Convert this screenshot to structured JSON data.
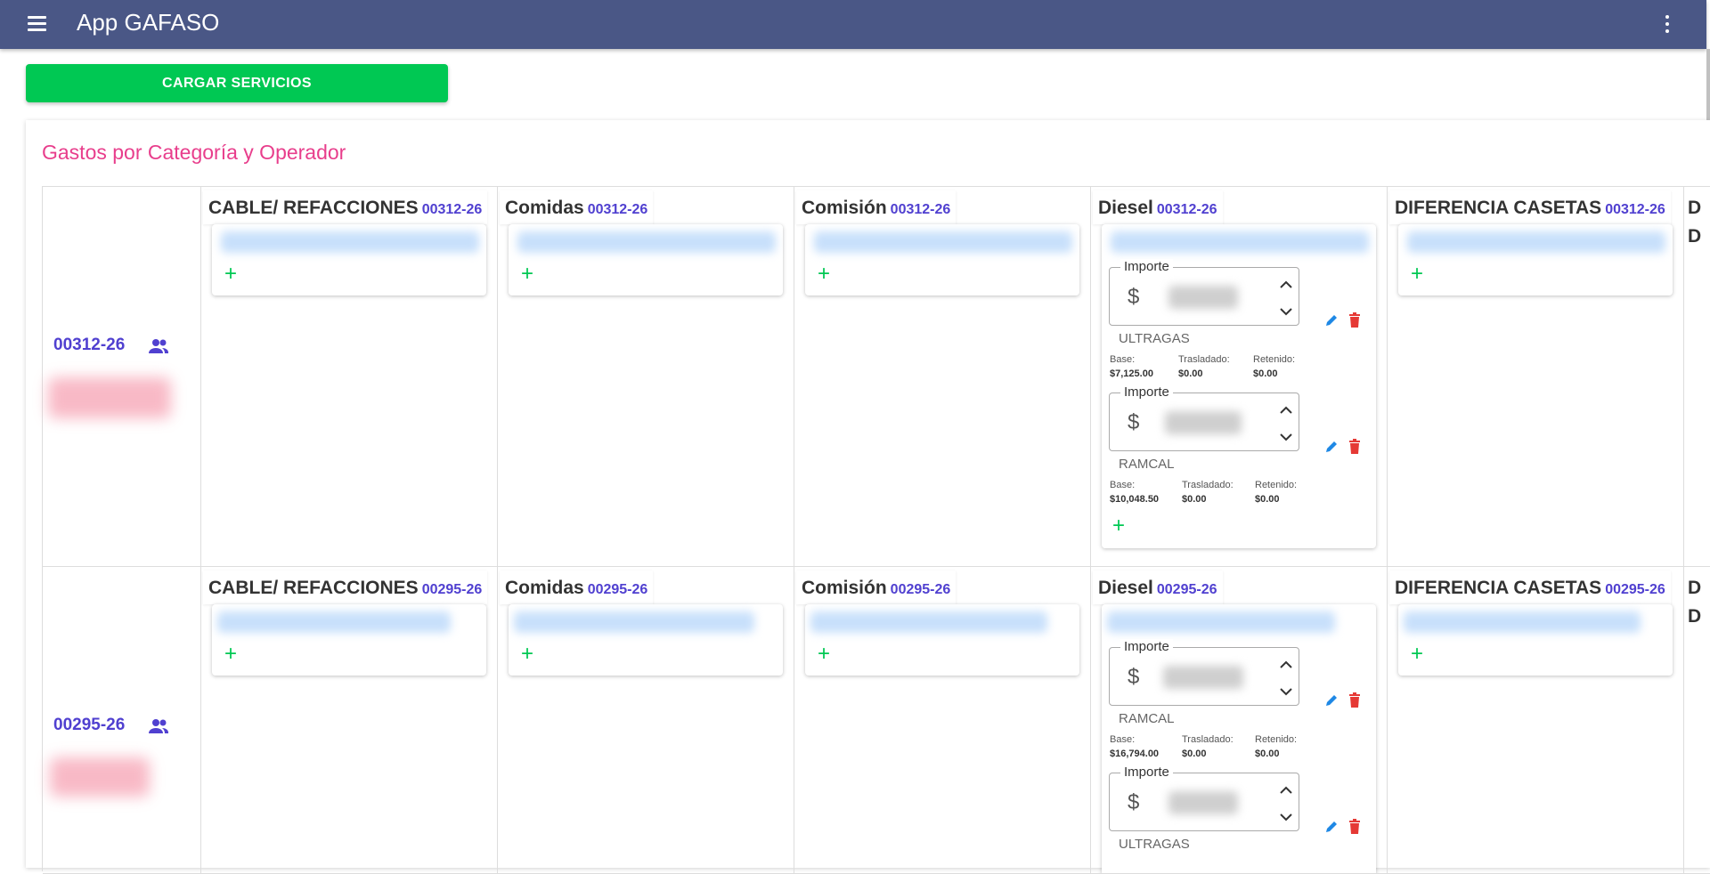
{
  "app": {
    "title": "App GAFASO"
  },
  "actions": {
    "cargar_label": "CARGAR SERVICIOS"
  },
  "section": {
    "title": "Gastos por Categoría y Operador"
  },
  "rows": [
    {
      "operator": "00312-26",
      "categories": [
        {
          "name": "CABLE/ REFACCIONES",
          "code": "00312-26"
        },
        {
          "name": "Comidas",
          "code": "00312-26"
        },
        {
          "name": "Comisión",
          "code": "00312-26"
        },
        {
          "name": "Diesel",
          "code": "00312-26"
        },
        {
          "name": "DIFERENCIA CASETAS",
          "code": "00312-26"
        }
      ],
      "diesel_entries": [
        {
          "label": "Importe",
          "currency": "$",
          "vendor": "ULTRAGAS",
          "base_label": "Base:",
          "base": "$7,125.00",
          "trasladado_label": "Trasladado:",
          "trasladado": "$0.00",
          "retenido_label": "Retenido:",
          "retenido": "$0.00"
        },
        {
          "label": "Importe",
          "currency": "$",
          "vendor": "RAMCAL",
          "base_label": "Base:",
          "base": "$10,048.50",
          "trasladado_label": "Trasladado:",
          "trasladado": "$0.00",
          "retenido_label": "Retenido:",
          "retenido": "$0.00"
        }
      ],
      "clipped": [
        "D",
        "D"
      ]
    },
    {
      "operator": "00295-26",
      "categories": [
        {
          "name": "CABLE/ REFACCIONES",
          "code": "00295-26"
        },
        {
          "name": "Comidas",
          "code": "00295-26"
        },
        {
          "name": "Comisión",
          "code": "00295-26"
        },
        {
          "name": "Diesel",
          "code": "00295-26"
        },
        {
          "name": "DIFERENCIA CASETAS",
          "code": "00295-26"
        }
      ],
      "diesel_entries": [
        {
          "label": "Importe",
          "currency": "$",
          "vendor": "RAMCAL",
          "base_label": "Base:",
          "base": "$16,794.00",
          "trasladado_label": "Trasladado:",
          "trasladado": "$0.00",
          "retenido_label": "Retenido:",
          "retenido": "$0.00"
        },
        {
          "label": "Importe",
          "currency": "$",
          "vendor": "ULTRAGAS"
        }
      ],
      "clipped": [
        "D",
        "D"
      ]
    }
  ],
  "icons": {
    "menu": "menu-icon",
    "more": "more-vert-icon",
    "group": "group-icon",
    "add": "plus-icon",
    "edit": "pencil-icon",
    "delete": "trash-icon",
    "up": "chevron-up-icon",
    "down": "chevron-down-icon"
  },
  "colors": {
    "appbar": "#4a5786",
    "primary_action": "#00c853",
    "title": "#e83e8c",
    "code": "#5040d0",
    "edit": "#1e88e5",
    "delete": "#e53935"
  },
  "plus_glyph": "+"
}
